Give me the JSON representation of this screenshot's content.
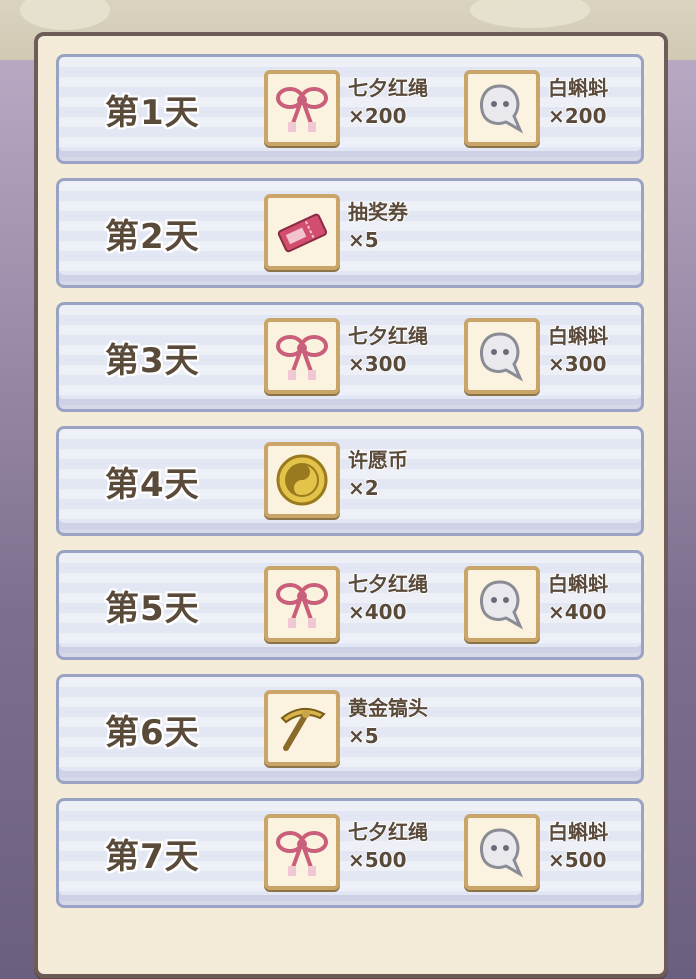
{
  "days": [
    {
      "label": "第1天",
      "items": [
        {
          "icon": "red-rope-icon",
          "name": "七夕红绳",
          "qty": "×200"
        },
        {
          "icon": "tadpole-icon",
          "name": "白蝌蚪",
          "qty": "×200"
        }
      ]
    },
    {
      "label": "第2天",
      "items": [
        {
          "icon": "lottery-ticket-icon",
          "name": "抽奖券",
          "qty": "×5"
        }
      ]
    },
    {
      "label": "第3天",
      "items": [
        {
          "icon": "red-rope-icon",
          "name": "七夕红绳",
          "qty": "×300"
        },
        {
          "icon": "tadpole-icon",
          "name": "白蝌蚪",
          "qty": "×300"
        }
      ]
    },
    {
      "label": "第4天",
      "items": [
        {
          "icon": "wish-coin-icon",
          "name": "许愿币",
          "qty": "×2"
        }
      ]
    },
    {
      "label": "第5天",
      "items": [
        {
          "icon": "red-rope-icon",
          "name": "七夕红绳",
          "qty": "×400"
        },
        {
          "icon": "tadpole-icon",
          "name": "白蝌蚪",
          "qty": "×400"
        }
      ]
    },
    {
      "label": "第6天",
      "items": [
        {
          "icon": "golden-pickaxe-icon",
          "name": "黄金镐头",
          "qty": "×5"
        }
      ]
    },
    {
      "label": "第7天",
      "items": [
        {
          "icon": "red-rope-icon",
          "name": "七夕红绳",
          "qty": "×500"
        },
        {
          "icon": "tadpole-icon",
          "name": "白蝌蚪",
          "qty": "×500"
        }
      ]
    }
  ],
  "colors": {
    "text": "#5a4a3a",
    "frame": "#c9a56a",
    "row_border": "#9aa3c4"
  }
}
